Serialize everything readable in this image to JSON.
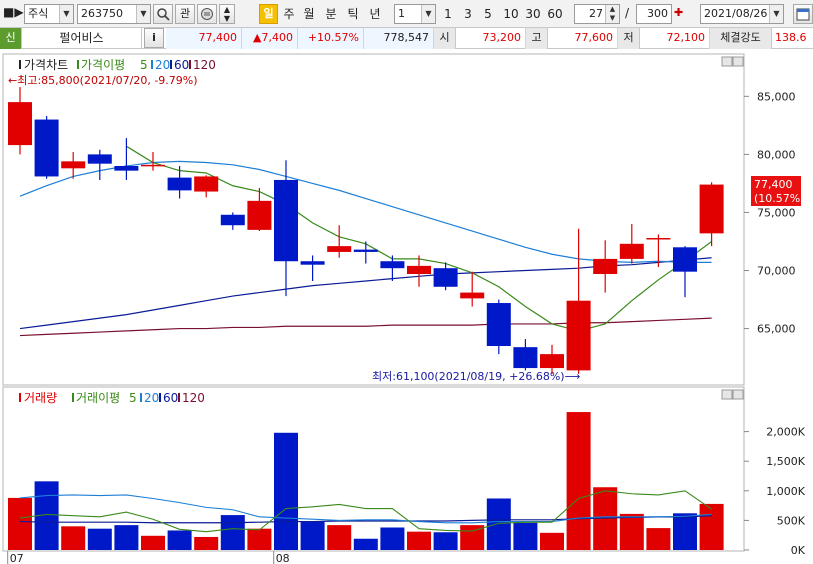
{
  "toolbar": {
    "market_select": "주식",
    "code": "263750",
    "btn_gwan": "관",
    "period_buttons": [
      "일",
      "주",
      "월",
      "분",
      "틱",
      "년"
    ],
    "active_period": "일",
    "multiplier": "1",
    "quick_periods": [
      "1",
      "3",
      "5",
      "10",
      "30",
      "60"
    ],
    "page_current": "27",
    "page_sep": "/",
    "page_total": "300",
    "date": "2021/08/26"
  },
  "quote": {
    "flag": "신",
    "name": "펄어비스",
    "info_btn": "i",
    "price": "77,400",
    "change": "▲7,400",
    "change_rate": "+10.57%",
    "volume": "778,547",
    "open_label": "시",
    "open": "73,200",
    "high_label": "고",
    "high": "77,600",
    "low_label": "저",
    "low": "72,100",
    "strength_label": "체결강도",
    "strength": "138.6"
  },
  "colors": {
    "up": "#e00000",
    "down": "#0019c8",
    "ma5": "#3a8a1a",
    "ma20": "#1c7fd6",
    "ma60": "#0a1b96",
    "ma120": "#7a1030",
    "volume_line": "#0a1b96"
  },
  "chart_data": [
    {
      "type": "candlestick",
      "legend": [
        "가격차트",
        "가격이평",
        "5",
        "20",
        "60",
        "120"
      ],
      "x_tick_labels": [
        {
          "index": 0,
          "label": "07"
        },
        {
          "index": 10,
          "label": "08"
        }
      ],
      "y_tick_labels": [
        "85,000",
        "80,000",
        "75,000",
        "70,000",
        "65,000"
      ],
      "y_ticks": [
        85000,
        80000,
        75000,
        70000,
        65000
      ],
      "ylim": [
        60400,
        88300
      ],
      "grid": false,
      "current_price_label": "77,400",
      "current_change_label": "(10.57%)",
      "annotation_high": "←최고:85,800(2021/07/20, -9.79%)",
      "annotation_low": "최저:61,100(2021/08/19, +26.68%)⟶",
      "candles": [
        {
          "o": 80800,
          "h": 85800,
          "l": 80000,
          "c": 84500
        },
        {
          "o": 83000,
          "h": 83300,
          "l": 77900,
          "c": 78100
        },
        {
          "o": 78800,
          "h": 80200,
          "l": 77900,
          "c": 79400
        },
        {
          "o": 80000,
          "h": 80400,
          "l": 77800,
          "c": 79200
        },
        {
          "o": 79000,
          "h": 81400,
          "l": 77800,
          "c": 78600
        },
        {
          "o": 79000,
          "h": 80200,
          "l": 78600,
          "c": 79100
        },
        {
          "o": 78000,
          "h": 79000,
          "l": 76200,
          "c": 76900
        },
        {
          "o": 76800,
          "h": 78200,
          "l": 76300,
          "c": 78100
        },
        {
          "o": 74800,
          "h": 75000,
          "l": 73500,
          "c": 73900
        },
        {
          "o": 73500,
          "h": 77100,
          "l": 73400,
          "c": 76000
        },
        {
          "o": 77800,
          "h": 79500,
          "l": 67800,
          "c": 70800
        },
        {
          "o": 70800,
          "h": 71300,
          "l": 69100,
          "c": 70500
        },
        {
          "o": 71600,
          "h": 73900,
          "l": 71100,
          "c": 72100
        },
        {
          "o": 71800,
          "h": 72500,
          "l": 70600,
          "c": 71600
        },
        {
          "o": 70800,
          "h": 71300,
          "l": 69100,
          "c": 70200
        },
        {
          "o": 69700,
          "h": 71300,
          "l": 68600,
          "c": 70400
        },
        {
          "o": 70200,
          "h": 70700,
          "l": 68300,
          "c": 68600
        },
        {
          "o": 67600,
          "h": 69900,
          "l": 66900,
          "c": 68100
        },
        {
          "o": 67200,
          "h": 67500,
          "l": 62800,
          "c": 63500
        },
        {
          "o": 63400,
          "h": 64100,
          "l": 61400,
          "c": 61600
        },
        {
          "o": 61600,
          "h": 63600,
          "l": 61100,
          "c": 62800
        },
        {
          "o": 61400,
          "h": 73600,
          "l": 61100,
          "c": 67400
        },
        {
          "o": 69700,
          "h": 72600,
          "l": 68100,
          "c": 71000
        },
        {
          "o": 71000,
          "h": 74000,
          "l": 70600,
          "c": 72300
        },
        {
          "o": 72700,
          "h": 73100,
          "l": 70300,
          "c": 72800
        },
        {
          "o": 72000,
          "h": 72100,
          "l": 67700,
          "c": 69900
        },
        {
          "o": 73200,
          "h": 77600,
          "l": 72100,
          "c": 77400
        }
      ],
      "ma5": [
        null,
        null,
        null,
        null,
        80700,
        79300,
        78600,
        78400,
        77300,
        76800,
        75700,
        74100,
        72900,
        72300,
        71000,
        71000,
        70600,
        69800,
        68600,
        66900,
        65400,
        64800,
        65400,
        67400,
        69200,
        70800,
        72500
      ],
      "ma20": [
        76400,
        77300,
        78100,
        78600,
        79000,
        79300,
        79400,
        79300,
        79100,
        78700,
        78100,
        77500,
        76900,
        76200,
        75500,
        74800,
        74100,
        73400,
        72700,
        72000,
        71400,
        71000,
        70800,
        70700,
        70800,
        70700,
        70700
      ],
      "ma60": [
        65000,
        65300,
        65600,
        65900,
        66200,
        66600,
        67000,
        67400,
        67800,
        68100,
        68400,
        68700,
        68900,
        69100,
        69300,
        69500,
        69700,
        69800,
        69900,
        70000,
        70100,
        70200,
        70400,
        70500,
        70700,
        70900,
        71100
      ],
      "ma120": [
        64400,
        64500,
        64600,
        64700,
        64800,
        64900,
        65000,
        65000,
        65100,
        65100,
        65200,
        65200,
        65200,
        65200,
        65300,
        65300,
        65300,
        65300,
        65400,
        65400,
        65400,
        65500,
        65500,
        65600,
        65700,
        65800,
        65900
      ]
    },
    {
      "type": "bar",
      "legend": [
        "거래량",
        "거래이평",
        "5",
        "20",
        "60",
        "120"
      ],
      "y_tick_labels": [
        "2,000K",
        "1,500K",
        "1,000K",
        "500K",
        "0K"
      ],
      "y_ticks": [
        2000000,
        1500000,
        1000000,
        500000,
        0
      ],
      "ylim": [
        0,
        2500000
      ],
      "volumes": [
        880000,
        1160000,
        400000,
        360000,
        420000,
        240000,
        330000,
        220000,
        590000,
        360000,
        1980000,
        490000,
        420000,
        190000,
        380000,
        310000,
        300000,
        420000,
        870000,
        460000,
        290000,
        2330000,
        1060000,
        610000,
        370000,
        620000,
        778547
      ],
      "vma5": [
        540000,
        600000,
        580000,
        560000,
        640000,
        520000,
        350000,
        310000,
        360000,
        340000,
        700000,
        730000,
        770000,
        700000,
        700000,
        360000,
        330000,
        320000,
        450000,
        470000,
        470000,
        870000,
        1000000,
        950000,
        930000,
        1000000,
        690000
      ],
      "vma20": [
        880000,
        920000,
        930000,
        920000,
        930000,
        870000,
        800000,
        720000,
        680000,
        560000,
        540000,
        520000,
        500000,
        510000,
        510000,
        480000,
        460000,
        460000,
        480000,
        480000,
        480000,
        540000,
        560000,
        560000,
        560000,
        570000,
        600000
      ],
      "vma60": [
        480000,
        470000,
        470000,
        470000,
        470000,
        460000,
        460000,
        460000,
        460000,
        470000,
        480000,
        480000,
        490000,
        490000,
        490000,
        490000,
        490000,
        500000,
        510000,
        510000,
        510000,
        530000,
        540000,
        550000,
        560000,
        560000,
        580000
      ]
    }
  ]
}
